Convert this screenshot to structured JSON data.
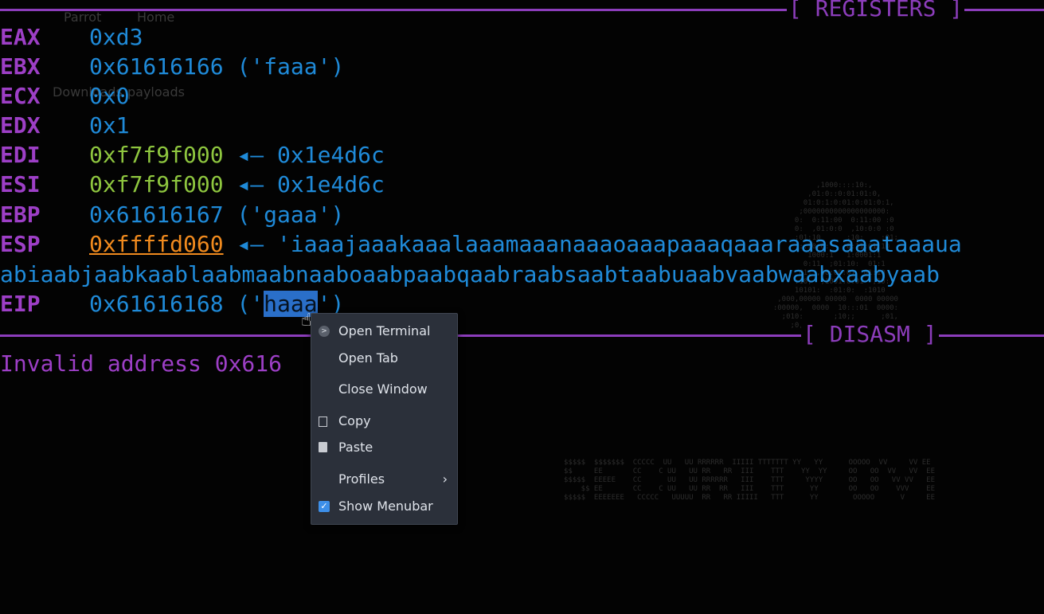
{
  "bg_ghost": {
    "item1": "Parrot",
    "item2": "Home",
    "item3": "Downloads",
    "item4": "payloads"
  },
  "separators": {
    "registers": "[ REGISTERS ]",
    "disasm": "[ DISASM ]"
  },
  "registers": [
    {
      "name": "EAX",
      "value": "0xd3",
      "extra": ""
    },
    {
      "name": "EBX",
      "value": "0x61616166",
      "extra": "('faaa')"
    },
    {
      "name": "ECX",
      "value": "0x0",
      "extra": ""
    },
    {
      "name": "EDX",
      "value": "0x1",
      "extra": ""
    },
    {
      "name": "EDI",
      "value": "0xf7f9f000",
      "arrow": "◂—",
      "extra": "0x1e4d6c"
    },
    {
      "name": "ESI",
      "value": "0xf7f9f000",
      "arrow": "◂—",
      "extra": "0x1e4d6c"
    },
    {
      "name": "EBP",
      "value": "0x61616167",
      "extra": "('gaaa')"
    },
    {
      "name": "ESP",
      "value": "0xffffd060",
      "arrow": "◂—",
      "extra": "'iaaajaaakaaalaaamaaanaaaoaaapaaaqaaaraaasaaataaaua",
      "wrap": "abiaabjaabkaablaabmaabnaaboaabpaabqaabraabsaabtaabuaabvaabwaabxaabyaab"
    },
    {
      "name": "EIP",
      "value": "0x61616168",
      "pre": "('",
      "selected": "haaa",
      "post": "')"
    }
  ],
  "disasm_line": "Invalid address 0x616",
  "context_menu": {
    "items": [
      {
        "label": "Open Terminal",
        "icon": "terminal-icon"
      },
      {
        "label": "Open Tab",
        "icon": ""
      },
      {
        "label": "Close Window",
        "icon": ""
      },
      {
        "label": "Copy",
        "icon": "copy-icon"
      },
      {
        "label": "Paste",
        "icon": "paste-icon"
      },
      {
        "label": "Profiles",
        "icon": "chevron-right-icon"
      },
      {
        "label": "Show Menubar",
        "icon": "checkbox-checked-icon",
        "checked": true
      }
    ]
  },
  "colors": {
    "purple": "#9d3fc6",
    "blue": "#1f8ad8",
    "green": "#8ec63f",
    "orange": "#f08a1e",
    "menu_bg": "#2b303a"
  }
}
